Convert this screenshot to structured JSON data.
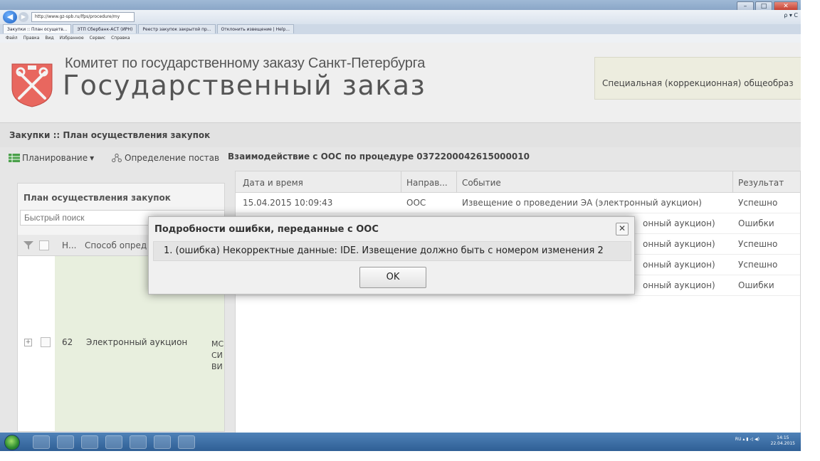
{
  "browser": {
    "address": "http://www.gz-spb.ru/lfps/procedure/my",
    "tabs": [
      "Закупки :: План осущетв...",
      "ЭТП Сбербанк-АСТ (ИРН)",
      "Реестр закупок закрытой пр...",
      "Отклонить извещение | Help..."
    ],
    "menu": [
      "Файл",
      "Правка",
      "Вид",
      "Избранное",
      "Сервис",
      "Справка"
    ],
    "nav_right": "ρ ▾ C",
    "title_buttons": [
      "–",
      "□",
      "✕"
    ]
  },
  "header": {
    "org_name": "Комитет по государственному заказу Санкт-Петербурга",
    "site_name": "Государственный заказ",
    "info_text": "Специальная (коррекционная) общеобраз"
  },
  "breadcrumb": "Закупки :: План осуществления закупок",
  "toolbar": {
    "planning": "Планирование",
    "supplier": "Определение постав"
  },
  "left_panel": {
    "title": "План осуществления закупок",
    "search_placeholder": "Быстрый поиск",
    "columns": [
      "Н...",
      "Способ опред"
    ],
    "row": {
      "number": "62",
      "method": "Электронный аукцион",
      "extra_lines": [
        "МС",
        "СИ",
        "ВИ"
      ]
    },
    "expand_glyph": "+"
  },
  "right_panel": {
    "title": "Взаимодействие с ООС по процедуре 0372200042615000010",
    "columns": [
      "Дата и время",
      "Направ...",
      "Событие",
      "Результат"
    ],
    "rows": [
      {
        "date": "15.04.2015 10:09:43",
        "dir": "ООС",
        "event": "Извещение о проведении ЭА (электронный аукцион)",
        "result": "Успешно"
      },
      {
        "date": "",
        "dir": "",
        "event": "онный аукцион)",
        "result": "Ошибки"
      },
      {
        "date": "",
        "dir": "",
        "event": "онный аукцион)",
        "result": "Успешно"
      },
      {
        "date": "",
        "dir": "",
        "event": "онный аукцион)",
        "result": "Успешно"
      },
      {
        "date": "",
        "dir": "",
        "event": "онный аукцион)",
        "result": "Ошибки"
      }
    ]
  },
  "modal": {
    "title": "Подробности ошибки, переданные с ООС",
    "message": "1. (ошибка) Некорректные данные: IDE. Извещение должно быть с номером изменения 2",
    "ok_label": "OK",
    "close_glyph": "✕"
  },
  "taskbar": {
    "tray": "RU ▴ ▮ ◁ ◀)",
    "time": "14:15",
    "date": "22.04.2015"
  },
  "colors": {
    "logo_red": "#e8675f",
    "accent_green": "#4aa04a",
    "row_highlight": "#e8efde"
  }
}
